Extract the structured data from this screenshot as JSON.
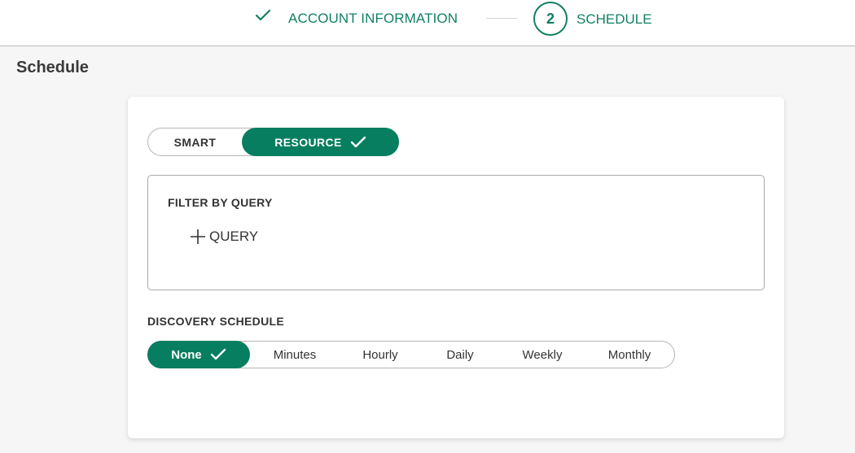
{
  "stepper": {
    "step1": {
      "label": "ACCOUNT INFORMATION",
      "status": "complete"
    },
    "step2": {
      "number": "2",
      "label": "SCHEDULE",
      "status": "active"
    },
    "accent_color": "#118064"
  },
  "page": {
    "title": "Schedule"
  },
  "mode_toggle": {
    "options": [
      "SMART",
      "RESOURCE"
    ],
    "selected": "RESOURCE"
  },
  "filter": {
    "title": "FILTER BY QUERY",
    "add_label": "QUERY"
  },
  "discovery": {
    "title": "DISCOVERY SCHEDULE",
    "options": [
      "None",
      "Minutes",
      "Hourly",
      "Daily",
      "Weekly",
      "Monthly"
    ],
    "selected": "None"
  },
  "colors": {
    "primary": "#077e60",
    "background": "#f6f6f6",
    "card": "#ffffff"
  }
}
